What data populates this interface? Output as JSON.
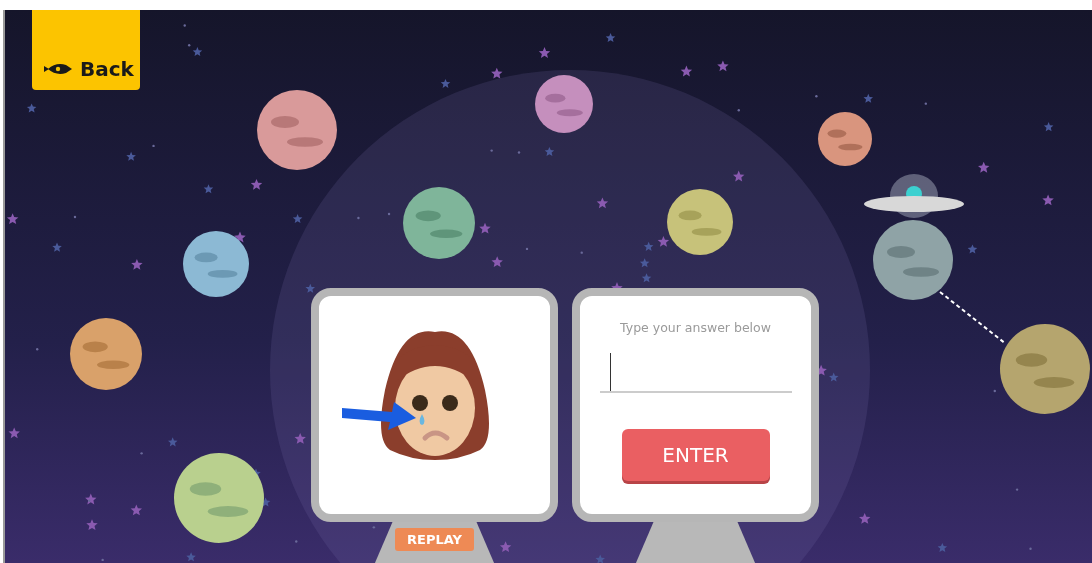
{
  "back_button": {
    "label": "Back"
  },
  "question_card": {
    "replay_button": {
      "label": "REPLAY"
    }
  },
  "answer_card": {
    "prompt": "Type your answer below",
    "enter_button": {
      "label": "ENTER"
    }
  }
}
